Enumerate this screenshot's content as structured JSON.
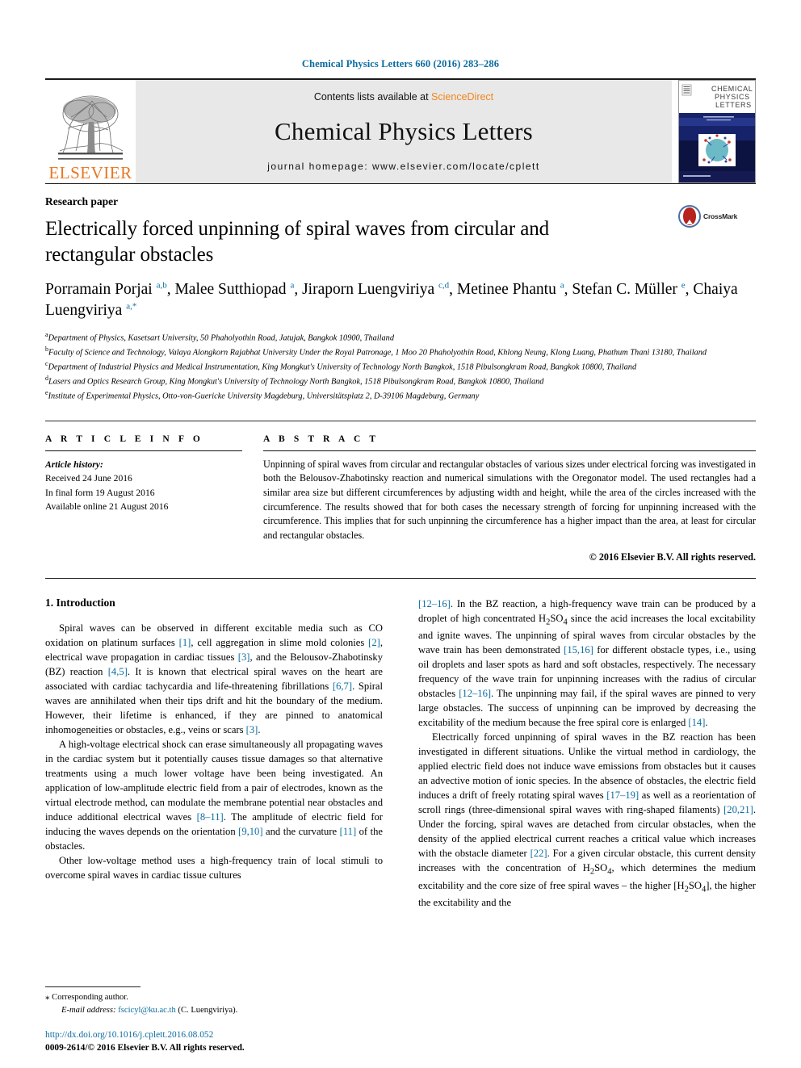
{
  "running_head": "Chemical Physics Letters 660 (2016) 283–286",
  "masthead": {
    "publisher_name": "ELSEVIER",
    "contents_prefix": "Contents lists available at ",
    "sciencedirect": "ScienceDirect",
    "journal_title": "Chemical Physics Letters",
    "homepage": "journal homepage: www.elsevier.com/locate/cplett",
    "cover_title_line1": "CHEMICAL",
    "cover_title_line2": "PHYSICS",
    "cover_title_line3": "LETTERS"
  },
  "article": {
    "type": "Research paper",
    "title": "Electrically forced unpinning of spiral waves from circular and rectangular obstacles",
    "crossmark_label": "CrossMark",
    "authors_html": "Porramain Porjai <sup>a,b</sup>, Malee Sutthiopad <sup>a</sup>, Jiraporn Luengviriya <sup>c,d</sup>, Metinee Phantu <sup>a</sup>, Stefan C. Müller <sup>e</sup>, Chaiya Luengviriya <sup>a,</sup><sup>*</sup>",
    "affiliations": [
      {
        "mark": "a",
        "text": "Department of Physics, Kasetsart University, 50 Phaholyothin Road, Jatujak, Bangkok 10900, Thailand"
      },
      {
        "mark": "b",
        "text": "Faculty of Science and Technology, Valaya Alongkorn Rajabhat University Under the Royal Patronage, 1 Moo 20 Phaholyothin Road, Khlong Neung, Klong Luang, Phathum Thani 13180, Thailand"
      },
      {
        "mark": "c",
        "text": "Department of Industrial Physics and Medical Instrumentation, King Mongkut's University of Technology North Bangkok, 1518 Pibulsongkram Road, Bangkok 10800, Thailand"
      },
      {
        "mark": "d",
        "text": "Lasers and Optics Research Group, King Mongkut's University of Technology North Bangkok, 1518 Pibulsongkram Road, Bangkok 10800, Thailand"
      },
      {
        "mark": "e",
        "text": "Institute of Experimental Physics, Otto-von-Guericke University Magdeburg, Universitätsplatz 2, D-39106 Magdeburg, Germany"
      }
    ]
  },
  "info": {
    "heading": "A R T I C L E   I N F O",
    "history_label": "Article history:",
    "history": [
      "Received 24 June 2016",
      "In final form 19 August 2016",
      "Available online 21 August 2016"
    ]
  },
  "abstract": {
    "heading": "A B S T R A C T",
    "text": "Unpinning of spiral waves from circular and rectangular obstacles of various sizes under electrical forcing was investigated in both the Belousov-Zhabotinsky reaction and numerical simulations with the Oregonator model. The used rectangles had a similar area size but different circumferences by adjusting width and height, while the area of the circles increased with the circumference. The results showed that for both cases the necessary strength of forcing for unpinning increased with the circumference. This implies that for such unpinning the circumference has a higher impact than the area, at least for circular and rectangular obstacles.",
    "copyright": "© 2016 Elsevier B.V. All rights reserved."
  },
  "body": {
    "section_title": "1. Introduction",
    "left_paragraphs_html": [
      "Spiral waves can be observed in different excitable media such as CO oxidation on platinum surfaces <span class=\"ref\">[1]</span>, cell aggregation in slime mold colonies <span class=\"ref\">[2]</span>, electrical wave propagation in cardiac tissues <span class=\"ref\">[3]</span>, and the Belousov-Zhabotinsky (BZ) reaction <span class=\"ref\">[4,5]</span>. It is known that electrical spiral waves on the heart are associated with cardiac tachycardia and life-threatening fibrillations <span class=\"ref\">[6,7]</span>. Spiral waves are annihilated when their tips drift and hit the boundary of the medium. However, their lifetime is enhanced, if they are pinned to anatomical inhomogeneities or obstacles, e.g., veins or scars <span class=\"ref\">[3]</span>.",
      "A high-voltage electrical shock can erase simultaneously all propagating waves in the cardiac system but it potentially causes tissue damages so that alternative treatments using a much lower voltage have been being investigated. An application of low-amplitude electric field from a pair of electrodes, known as the virtual electrode method, can modulate the membrane potential near obstacles and induce additional electrical waves <span class=\"ref\">[8–11]</span>. The amplitude of electric field for inducing the waves depends on the orientation <span class=\"ref\">[9,10]</span> and the curvature <span class=\"ref\">[11]</span> of the obstacles.",
      "Other low-voltage method uses a high-frequency train of local stimuli to overcome spiral waves in cardiac tissue cultures"
    ],
    "right_paragraphs_html": [
      "<span class=\"ref\">[12–16]</span>. In the BZ reaction, a high-frequency wave train can be produced by a droplet of high concentrated H<sub>2</sub>SO<sub>4</sub> since the acid increases the local excitability and ignite waves. The unpinning of spiral waves from circular obstacles by the wave train has been demonstrated <span class=\"ref\">[15,16]</span> for different obstacle types, i.e., using oil droplets and laser spots as hard and soft obstacles, respectively. The necessary frequency of the wave train for unpinning increases with the radius of circular obstacles <span class=\"ref\">[12–16]</span>. The unpinning may fail, if the spiral waves are pinned to very large obstacles. The success of unpinning can be improved by decreasing the excitability of the medium because the free spiral core is enlarged <span class=\"ref\">[14]</span>.",
      "Electrically forced unpinning of spiral waves in the BZ reaction has been investigated in different situations. Unlike the virtual method in cardiology, the applied electric field does not induce wave emissions from obstacles but it causes an advective motion of ionic species. In the absence of obstacles, the electric field induces a drift of freely rotating spiral waves <span class=\"ref\">[17–19]</span> as well as a reorientation of scroll rings (three-dimensional spiral waves with ring-shaped filaments) <span class=\"ref\">[20,21]</span>. Under the forcing, spiral waves are detached from circular obstacles, when the density of the applied electrical current reaches a critical value which increases with the obstacle diameter <span class=\"ref\">[22]</span>. For a given circular obstacle, this current density increases with the concentration of H<sub>2</sub>SO<sub>4</sub>, which determines the medium excitability and the core size of free spiral waves – the higher [H<sub>2</sub>SO<sub>4</sub>], the higher the excitability and the"
    ]
  },
  "footer": {
    "corresponding_star": "⁎",
    "corresponding_label": "Corresponding author.",
    "email_label": "E-mail address:",
    "email": "fscicyl@ku.ac.th",
    "email_suffix": "(C. Luengviriya).",
    "doi": "http://dx.doi.org/10.1016/j.cplett.2016.08.052",
    "issn_line": "0009-2614/© 2016 Elsevier B.V. All rights reserved."
  },
  "colors": {
    "link": "#0b6ca0",
    "elsevier_orange": "#E87722",
    "sciencedirect_orange": "#f0861b"
  }
}
